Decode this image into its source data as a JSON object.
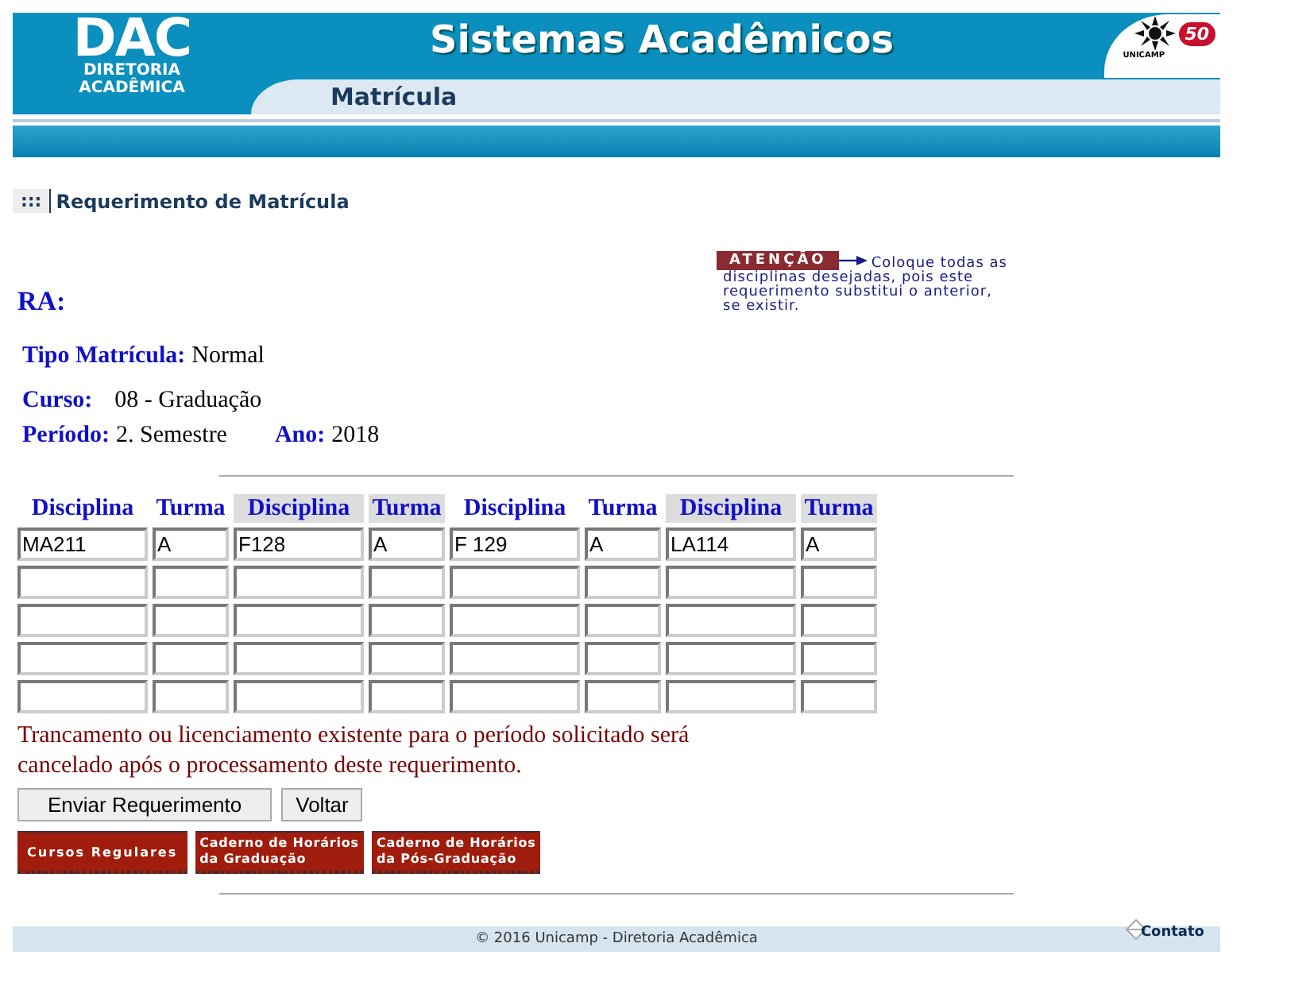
{
  "header": {
    "logo": "DAC",
    "logo_sub": [
      "DIRETORIA",
      "ACADÊMICA"
    ],
    "title": "Sistemas Acadêmicos",
    "subtitle": "Matrícula",
    "university": "UNICAMP",
    "badge": "50"
  },
  "breadcrumb": {
    "marker": ":::",
    "title": "Requerimento de Matrícula"
  },
  "notice": {
    "label": "ATENÇÃO",
    "lines": [
      "Coloque todas as",
      "disciplinas desejadas, pois este",
      "requerimento substitui o anterior,",
      "se existir."
    ]
  },
  "ra": {
    "label": "RA:"
  },
  "fields": [
    {
      "label": "Tipo Matrícula:",
      "value": "Normal"
    },
    {
      "label": "Curso:",
      "value": "08 - Graduação"
    }
  ],
  "period": {
    "label": "Período:",
    "value": "2. Semestre",
    "year_label": "Ano:",
    "year": "2018"
  },
  "table": {
    "columns": [
      {
        "label": "Disciplina",
        "shaded": false,
        "kind": "wide"
      },
      {
        "label": "Turma",
        "shaded": false,
        "kind": "narrow"
      },
      {
        "label": "Disciplina",
        "shaded": true,
        "kind": "wide"
      },
      {
        "label": "Turma",
        "shaded": true,
        "kind": "narrow"
      },
      {
        "label": "Disciplina",
        "shaded": false,
        "kind": "wide"
      },
      {
        "label": "Turma",
        "shaded": false,
        "kind": "narrow"
      },
      {
        "label": "Disciplina",
        "shaded": true,
        "kind": "wide"
      },
      {
        "label": "Turma",
        "shaded": true,
        "kind": "narrow"
      }
    ],
    "rows": [
      {
        "cells": [
          {
            "value": "MA211"
          },
          {
            "value": "A"
          },
          {
            "value": "F128"
          },
          {
            "value": "A"
          },
          {
            "value": "F 129"
          },
          {
            "value": "A"
          },
          {
            "value": "LA114"
          },
          {
            "value": "A"
          }
        ]
      },
      {
        "cells": [
          {},
          {},
          {},
          {},
          {},
          {},
          {},
          {}
        ]
      },
      {
        "cells": [
          {},
          {},
          {},
          {},
          {},
          {},
          {},
          {}
        ]
      },
      {
        "cells": [
          {},
          {},
          {},
          {},
          {},
          {},
          {},
          {}
        ]
      },
      {
        "cells": [
          {},
          {},
          {},
          {},
          {},
          {},
          {},
          {}
        ]
      }
    ]
  },
  "warning": [
    "Trancamento ou licenciamento existente para o período solicitado será",
    "cancelado após o processamento deste requerimento."
  ],
  "buttons": [
    "Enviar Requerimento",
    "Voltar"
  ],
  "links": [
    [
      "Cursos Regulares"
    ],
    [
      "Caderno de Horários",
      "da Graduação"
    ],
    [
      "Caderno de Horários",
      "da Pós-Graduação"
    ]
  ],
  "footer": {
    "copyright": "© 2016 Unicamp - Diretoria Acadêmica",
    "contact": "Contato"
  }
}
